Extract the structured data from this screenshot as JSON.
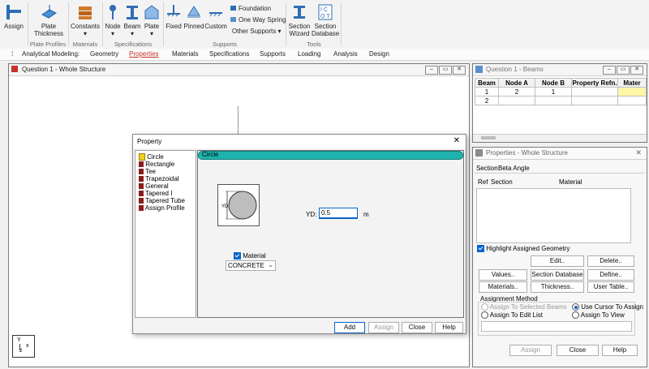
{
  "ribbon": {
    "assign": "Assign",
    "plate_thickness_line1": "Plate",
    "plate_thickness_line2": "Thickness",
    "constants": "Constants",
    "node": "Node",
    "beam": "Beam",
    "plate": "Plate",
    "fixed": "Fixed",
    "pinned": "Pinned",
    "custom": "Custom",
    "foundation": "Foundation",
    "one_way_spring": "One Way Spring",
    "other_supports": "Other Supports",
    "section_wizard_line1": "Section",
    "section_wizard_line2": "Wizard",
    "section_database_line1": "Section",
    "section_database_line2": "Database",
    "groups": {
      "plate_profiles": "Plate Profiles",
      "materials": "Materials",
      "specifications": "Specifications",
      "supports": "Supports",
      "tools": "Tools"
    }
  },
  "menubar": {
    "prefix": "Analytical Modeling:",
    "items": [
      "Geometry",
      "Properties",
      "Materials",
      "Specifications",
      "Supports",
      "Loading",
      "Analysis",
      "Design"
    ],
    "active": "Properties"
  },
  "main_window": {
    "title": "Question 1 - Whole Structure"
  },
  "beams_window": {
    "title": "Question 1 - Beams",
    "columns": [
      "Beam",
      "Node A",
      "Node B",
      "Property Refn.",
      "Mater"
    ],
    "rows": [
      [
        "1",
        "2",
        "1",
        "",
        ""
      ],
      [
        "2",
        "",
        "",
        "",
        ""
      ]
    ]
  },
  "properties_window": {
    "title": "Properties - Whole Structure",
    "tabs": [
      "Section",
      "Beta Angle"
    ],
    "list_headers": [
      "Ref",
      "Section",
      "Material"
    ],
    "highlight_label": "Highlight Assigned Geometry",
    "buttons": {
      "edit": "Edit..",
      "delete": "Delete..",
      "values": "Values..",
      "section_database": "Section Database",
      "define": "Define..",
      "materials": "Materials..",
      "thickness": "Thickness..",
      "user_table": "User Table.."
    },
    "assign_method": {
      "title": "Assignment Method",
      "to_selected": "Assign To Selected Beams",
      "use_cursor": "Use Cursor To Assign",
      "to_edit_list": "Assign To Edit List",
      "to_view": "Assign To View"
    },
    "footer": {
      "assign": "Assign",
      "close": "Close",
      "help": "Help"
    }
  },
  "property_dialog": {
    "title": "Property",
    "tree": [
      "Circle",
      "Rectangle",
      "Tee",
      "Trapezoidal",
      "General",
      "Tapered I",
      "Tapered Tube",
      "Assign Profile"
    ],
    "selected": "Circle",
    "panel_title": "Circle",
    "yd_label": "YD:",
    "yd_value": "0.5",
    "unit": "m",
    "shape_dim_label": "YD",
    "material_label": "Material",
    "material_value": "CONCRETE",
    "buttons": {
      "add": "Add",
      "assign": "Assign",
      "close": "Close",
      "help": "Help"
    }
  },
  "axis": {
    "y": "Y",
    "x": "x",
    "z": "z"
  },
  "colors": {
    "teal_header": "#1fb3ad",
    "accent_blue": "#0a64c8",
    "selected_cell": "#fff7a8",
    "menu_active": "#c8322a"
  }
}
